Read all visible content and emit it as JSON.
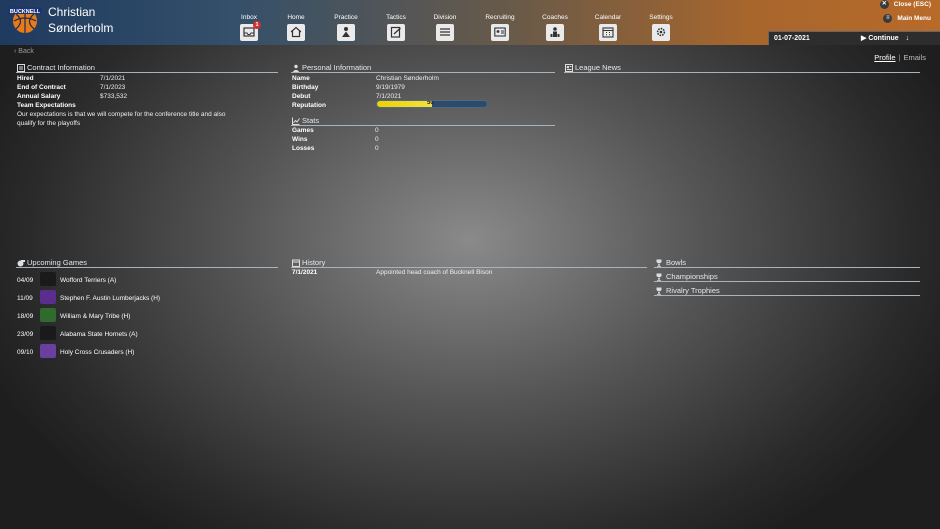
{
  "coach": {
    "first_name": "Christian",
    "last_name": "Sønderholm"
  },
  "nav": [
    {
      "label": "Inbox",
      "icon": "inbox-icon",
      "badge": "1"
    },
    {
      "label": "Home",
      "icon": "home-icon"
    },
    {
      "label": "Practice",
      "icon": "practice-icon"
    },
    {
      "label": "Tactics",
      "icon": "tactics-icon"
    },
    {
      "label": "Division",
      "icon": "division-icon"
    },
    {
      "label": "Recruiting",
      "icon": "recruiting-icon"
    },
    {
      "label": "Coaches",
      "icon": "coaches-icon"
    },
    {
      "label": "Calendar",
      "icon": "calendar-icon"
    },
    {
      "label": "Settings",
      "icon": "settings-icon"
    }
  ],
  "top_right": {
    "close_label": "Close (ESC)",
    "menu_label": "Main Menu",
    "date": "01-07-2021",
    "continue_label": "Continue"
  },
  "back_label": "Back",
  "tabs": {
    "profile": "Profile",
    "separator": "|",
    "emails": "Emails"
  },
  "contract": {
    "title": "Contract Information",
    "hired_label": "Hired",
    "hired": "7/1/2021",
    "end_label": "End of Contract",
    "end": "7/1/2023",
    "salary_label": "Annual Salary",
    "salary": "$733,532",
    "expect_label": "Team Expectations",
    "expect_text": "Our expectations is that we will compete for the conference title and also qualify for the playoffs"
  },
  "personal": {
    "title": "Personal Information",
    "name_label": "Name",
    "name": "Christian Sønderholm",
    "birthday_label": "Birthday",
    "birthday": "9/19/1979",
    "debut_label": "Debut",
    "debut": "7/1/2021",
    "reputation_label": "Reputation",
    "reputation": "50",
    "reputation_fraction": 0.5
  },
  "stats": {
    "title": "Stats",
    "games_label": "Games",
    "games": "0",
    "wins_label": "Wins",
    "wins": "0",
    "losses_label": "Losses",
    "losses": "0"
  },
  "league_news": {
    "title": "League News"
  },
  "upcoming": {
    "title": "Upcoming Games",
    "games": [
      {
        "date": "04/09",
        "team": "Wofford Terriers (A)",
        "color": "#1a1a1a"
      },
      {
        "date": "11/09",
        "team": "Stephen F. Austin Lumberjacks (H)",
        "color": "#5b2d8c"
      },
      {
        "date": "18/09",
        "team": "William & Mary Tribe (H)",
        "color": "#2f6b2f"
      },
      {
        "date": "23/09",
        "team": "Alabama State Hornets (A)",
        "color": "#1a1a1a"
      },
      {
        "date": "09/10",
        "team": "Holy Cross Crusaders (H)",
        "color": "#6a3fa0"
      }
    ]
  },
  "history": {
    "title": "History",
    "date": "7/1/2021",
    "event": "Appointed head coach of Bucknell Bison"
  },
  "trophies": {
    "bowls": "Bowls",
    "championships": "Championships",
    "rivalry": "Rivalry Trophies"
  },
  "logo_text": "BUCKNELL"
}
